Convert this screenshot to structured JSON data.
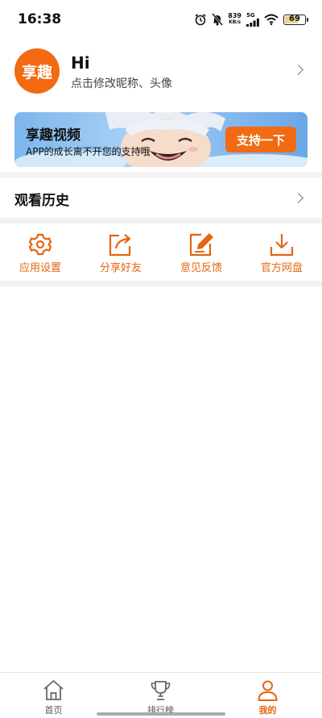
{
  "status_bar": {
    "time": "16:38",
    "net_speed_value": "839",
    "net_speed_unit": "KB/s",
    "network_type": "5G",
    "battery_level": "69",
    "icons": [
      "alarm-icon",
      "mute-icon",
      "signal-icon",
      "wifi-icon",
      "battery-icon"
    ]
  },
  "profile": {
    "avatar_text": "享趣",
    "name": "Hi",
    "subtitle": "点击修改昵称、头像"
  },
  "banner": {
    "title": "享趣视频",
    "subtitle": "APP的成长离不开您的支持哦",
    "button_label": "支持一下"
  },
  "history": {
    "label": "观看历史"
  },
  "actions": [
    {
      "label": "应用设置",
      "icon": "gear-icon"
    },
    {
      "label": "分享好友",
      "icon": "share-icon"
    },
    {
      "label": "意见反馈",
      "icon": "edit-icon"
    },
    {
      "label": "官方网盘",
      "icon": "download-icon"
    }
  ],
  "tabbar": {
    "items": [
      {
        "label": "首页",
        "icon": "home-icon",
        "active": false
      },
      {
        "label": "排行榜",
        "icon": "trophy-icon",
        "active": false
      },
      {
        "label": "我的",
        "icon": "user-icon",
        "active": true
      }
    ]
  },
  "colors": {
    "accent": "#f26a12",
    "accent_text": "#e5650f",
    "divider": "#f2f2f2"
  }
}
